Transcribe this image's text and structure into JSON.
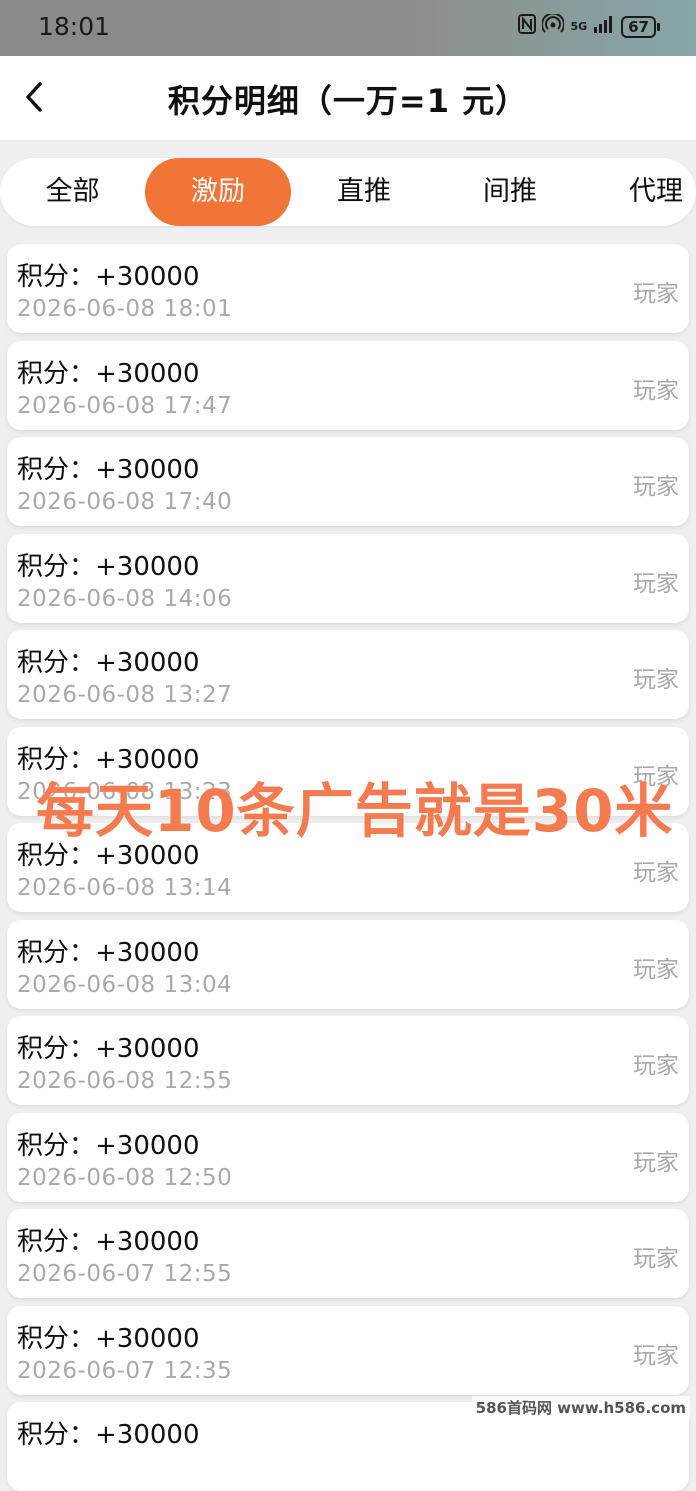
{
  "status_bar": {
    "time": "18:01",
    "signal_text": "5G",
    "battery": "67"
  },
  "header": {
    "back_icon": "chevron-left-icon",
    "title": "积分明细（一万=1 元）"
  },
  "tabs": [
    {
      "label": "全部",
      "active": false
    },
    {
      "label": "激励",
      "active": true
    },
    {
      "label": "直推",
      "active": false
    },
    {
      "label": "间推",
      "active": false
    },
    {
      "label": "代理",
      "active": false
    }
  ],
  "records": [
    {
      "amount": "积分：+30000",
      "date": "2026-06-08 18:01",
      "type": "玩家"
    },
    {
      "amount": "积分：+30000",
      "date": "2026-06-08 17:47",
      "type": "玩家"
    },
    {
      "amount": "积分：+30000",
      "date": "2026-06-08 17:40",
      "type": "玩家"
    },
    {
      "amount": "积分：+30000",
      "date": "2026-06-08 14:06",
      "type": "玩家"
    },
    {
      "amount": "积分：+30000",
      "date": "2026-06-08 13:27",
      "type": "玩家"
    },
    {
      "amount": "积分：+30000",
      "date": "2026-06-08 13:23",
      "type": "玩家"
    },
    {
      "amount": "积分：+30000",
      "date": "2026-06-08 13:14",
      "type": "玩家"
    },
    {
      "amount": "积分：+30000",
      "date": "2026-06-08  13:04",
      "type": "玩家"
    },
    {
      "amount": "积分：+30000",
      "date": "2026-06-08 12:55",
      "type": "玩家"
    },
    {
      "amount": "积分：+30000",
      "date": "2026-06-08 12:50",
      "type": "玩家"
    },
    {
      "amount": "积分：+30000",
      "date": "2026-06-07 12:55",
      "type": "玩家"
    },
    {
      "amount": "积分：+30000",
      "date": "2026-06-07 12:35",
      "type": "玩家"
    },
    {
      "amount": "积分：+30000",
      "date": "",
      "type": ""
    }
  ],
  "overlay_caption": "每天10条广告就是30米",
  "watermark": "586首码网 www.h586.com",
  "colors": {
    "accent": "#f07537",
    "overlay": "#f47b50",
    "muted_text": "#a9a9a9"
  }
}
